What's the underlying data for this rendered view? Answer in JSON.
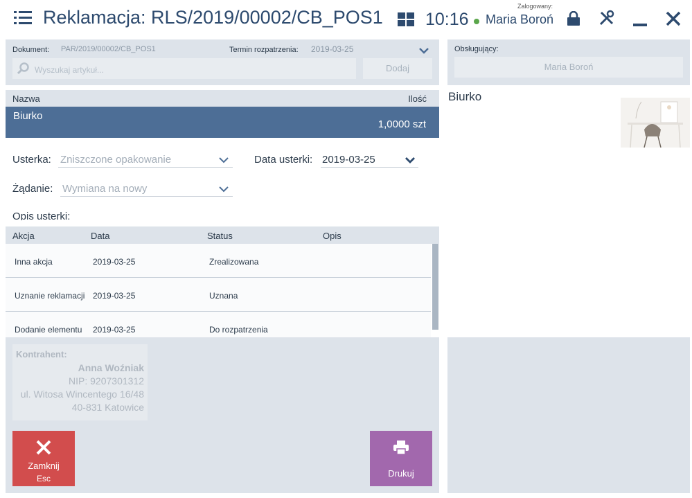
{
  "header": {
    "title": "Reklamacja: RLS/2019/00002/CB_POS1",
    "time": "10:16",
    "logged_label": "Zalogowany:",
    "user": "Maria Boroń"
  },
  "document_bar": {
    "doc_label": "Dokument:",
    "doc_value": "PAR/2019/00002/CB_POS1",
    "deadline_label": "Termin rozpatrzenia:",
    "deadline_value": "2019-03-25",
    "search_placeholder": "Wyszukaj artykuł...",
    "add_label": "Dodaj"
  },
  "operator": {
    "label": "Obsługujący:",
    "value": "Maria Boroń"
  },
  "items": {
    "col_name": "Nazwa",
    "col_qty": "Ilość",
    "rows": [
      {
        "name": "Biurko",
        "qty": "1,0000 szt"
      }
    ]
  },
  "form": {
    "defect_label": "Usterka:",
    "defect_value": "Zniszczone opakowanie",
    "defect_date_label": "Data usterki:",
    "defect_date_value": "2019-03-25",
    "request_label": "Żądanie:",
    "request_value": "Wymiana na nowy",
    "description_label": "Opis usterki:"
  },
  "actions": {
    "columns": [
      "Akcja",
      "Data",
      "Status",
      "Opis"
    ],
    "rows": [
      {
        "action": "Inna akcja",
        "date": "2019-03-25",
        "status": "Zrealizowana",
        "desc": ""
      },
      {
        "action": "Uznanie reklamacji",
        "date": "2019-03-25",
        "status": "Uznana",
        "desc": ""
      },
      {
        "action": "Dodanie elementu",
        "date": "2019-03-25",
        "status": "Do rozpatrzenia",
        "desc": ""
      }
    ]
  },
  "contractor": {
    "label": "Kontrahent:",
    "name": "Anna Woźniak",
    "nip": "NIP: 9207301312",
    "street": "ul. Witosa Wincentego 16/48",
    "city": "40-831 Katowice"
  },
  "buttons": {
    "close_label": "Zamknij",
    "close_key": "Esc",
    "print_label": "Drukuj"
  },
  "product_preview": {
    "name": "Biurko"
  },
  "colors": {
    "accent": "#2d4a6e",
    "selected_row": "#4d6e96",
    "close_button": "#d24d4d",
    "print_button": "#a268ad",
    "online_status": "#5aa64a"
  }
}
